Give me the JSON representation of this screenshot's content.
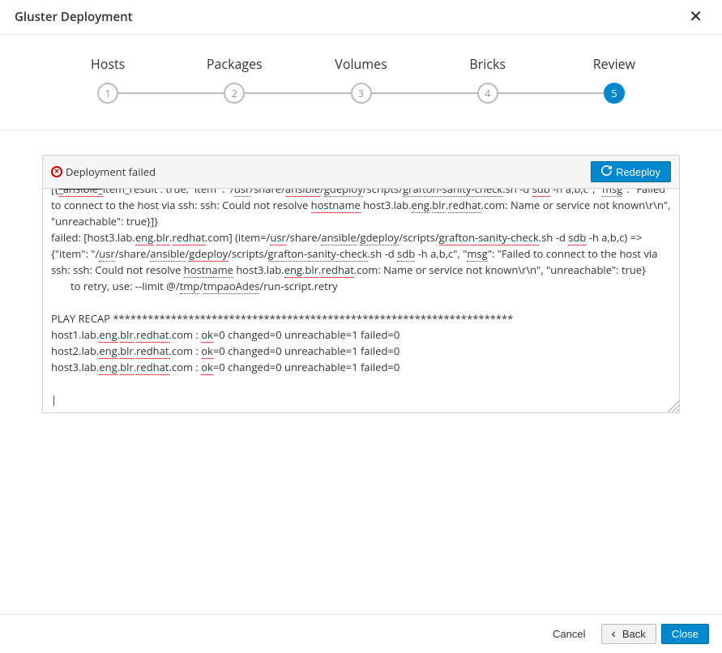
{
  "header": {
    "title": "Gluster Deployment"
  },
  "wizard": {
    "steps": [
      {
        "label": "Hosts",
        "num": "1"
      },
      {
        "label": "Packages",
        "num": "2"
      },
      {
        "label": "Volumes",
        "num": "3"
      },
      {
        "label": "Bricks",
        "num": "4"
      },
      {
        "label": "Review",
        "num": "5"
      }
    ],
    "active_index": 4
  },
  "status": {
    "label": "Deployment failed",
    "redeploy_label": "Redeploy"
  },
  "log": {
    "host1_prefix": "[{_ansible_item_result : true, \"item\" : \"/",
    "script_path_parts": [
      "usr",
      "/share/",
      "ansible",
      "/",
      "gdeploy",
      "/scripts/",
      "grafton-sanity-check",
      ".sh -d ",
      "sdb",
      " -h a,b,c\", \"",
      "msg",
      "\": \"Failed to connect to the host via ssh: ssh: Could not resolve ",
      "hostname",
      " host3.lab.",
      "eng",
      ".",
      "blr",
      ".",
      "redhat",
      ".com: Name or service not known\\r\\n\", \"unreachable\": true}]}"
    ],
    "line2": "failed: [host3.lab.",
    "line2_parts": [
      "eng",
      ".",
      "blr",
      ".",
      "redhat",
      ".com] (item=/",
      "usr",
      "/share/",
      "ansible",
      "/",
      "gdeploy",
      "/scripts/",
      "grafton-sanity-check",
      ".sh -d ",
      "sdb",
      " -h a,b,c) => {\"item\": \"/",
      "usr",
      "/share/",
      "ansible",
      "/",
      "gdeploy",
      "/scripts/",
      "grafton-sanity-check",
      ".sh -d ",
      "sdb",
      " -h a,b,c\", \"",
      "msg",
      "\": \"Failed to connect to the host via ssh: ssh: Could not resolve ",
      "hostname",
      " host3.lab.",
      "eng",
      ".",
      "blr",
      ".",
      "redhat",
      ".com: Name or service not known\\r\\n\", \"unreachable\": true}"
    ],
    "retry_prefix": "to retry, use: --limit @/",
    "retry_parts": [
      "tmp",
      "/",
      "tmpaoAdes",
      "/run-script.retry"
    ],
    "recap_header": "PLAY RECAP *********************************************************************",
    "recap_rows": [
      {
        "host": "host1.lab.",
        "tail": [
          "eng",
          ".",
          "blr",
          ".",
          "redhat",
          ".com : ",
          "ok",
          "=0    changed=0    unreachable=1    failed=0"
        ]
      },
      {
        "host": "host2.lab.",
        "tail": [
          "eng",
          ".",
          "blr",
          ".",
          "redhat",
          ".com : ",
          "ok",
          "=0    changed=0    unreachable=1    failed=0"
        ]
      },
      {
        "host": "host3.lab.",
        "tail": [
          "eng",
          ".",
          "blr",
          ".",
          "redhat",
          ".com : ",
          "ok",
          "=0    changed=0    unreachable=1    failed=0"
        ]
      }
    ]
  },
  "footer": {
    "cancel": "Cancel",
    "back": "Back",
    "close": "Close"
  },
  "colors": {
    "primary": "#0088ce",
    "error": "#cc0000"
  }
}
